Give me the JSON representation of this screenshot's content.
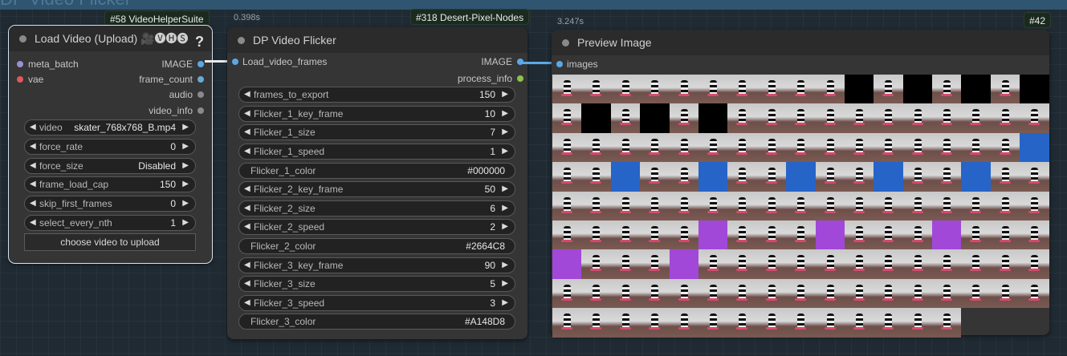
{
  "group": {
    "title": "DP Video Flicker"
  },
  "load_node": {
    "badge": "#58 VideoHelperSuite",
    "title": "Load Video (Upload) 🎥🅥🅗🅢",
    "help": "?",
    "inputs": [
      "meta_batch",
      "vae"
    ],
    "outputs": [
      "IMAGE",
      "frame_count",
      "audio",
      "video_info"
    ],
    "widgets": [
      {
        "label": "video",
        "value": "skater_768x768_B.mp4"
      },
      {
        "label": "force_rate",
        "value": "0"
      },
      {
        "label": "force_size",
        "value": "Disabled"
      },
      {
        "label": "frame_load_cap",
        "value": "150"
      },
      {
        "label": "skip_first_frames",
        "value": "0"
      },
      {
        "label": "select_every_nth",
        "value": "1"
      }
    ],
    "upload_label": "choose video to upload"
  },
  "flicker_node": {
    "time": "0.398s",
    "badge": "#318 Desert-Pixel-Nodes",
    "title": "DP Video Flicker",
    "input": "Load_video_frames",
    "outputs": [
      "IMAGE",
      "process_info"
    ],
    "widgets": [
      {
        "label": "frames_to_export",
        "value": "150",
        "type": "number"
      },
      {
        "label": "Flicker_1_key_frame",
        "value": "10",
        "type": "number"
      },
      {
        "label": "Flicker_1_size",
        "value": "7",
        "type": "number"
      },
      {
        "label": "Flicker_1_speed",
        "value": "1",
        "type": "number"
      },
      {
        "label": "Flicker_1_color",
        "value": "#000000",
        "type": "text"
      },
      {
        "label": "Flicker_2_key_frame",
        "value": "50",
        "type": "number"
      },
      {
        "label": "Flicker_2_size",
        "value": "6",
        "type": "number"
      },
      {
        "label": "Flicker_2_speed",
        "value": "2",
        "type": "number"
      },
      {
        "label": "Flicker_2_color",
        "value": "#2664C8",
        "type": "text"
      },
      {
        "label": "Flicker_3_key_frame",
        "value": "90",
        "type": "number"
      },
      {
        "label": "Flicker_3_size",
        "value": "5",
        "type": "number"
      },
      {
        "label": "Flicker_3_speed",
        "value": "3",
        "type": "number"
      },
      {
        "label": "Flicker_3_color",
        "value": "#A148D8",
        "type": "text"
      }
    ]
  },
  "preview_node": {
    "time": "3.247s",
    "badge": "#42",
    "title": "Preview Image",
    "input": "images",
    "frames": [
      "f",
      "f",
      "f",
      "f",
      "f",
      "f",
      "f",
      "f",
      "f",
      "f",
      "k",
      "f",
      "k",
      "f",
      "k",
      "f",
      "k",
      "f",
      "k",
      "f",
      "k",
      "f",
      "k",
      "f",
      "f",
      "f",
      "f",
      "f",
      "f",
      "f",
      "f",
      "f",
      "f",
      "f",
      "f",
      "f",
      "f",
      "f",
      "f",
      "f",
      "f",
      "f",
      "f",
      "f",
      "f",
      "f",
      "f",
      "f",
      "f",
      "f",
      "b",
      "f",
      "f",
      "b",
      "f",
      "f",
      "b",
      "f",
      "f",
      "b",
      "f",
      "f",
      "b",
      "f",
      "f",
      "b",
      "f",
      "f",
      "f",
      "f",
      "f",
      "f",
      "f",
      "f",
      "f",
      "f",
      "f",
      "f",
      "f",
      "f",
      "f",
      "f",
      "f",
      "f",
      "f",
      "f",
      "f",
      "f",
      "f",
      "f",
      "p",
      "f",
      "f",
      "f",
      "p",
      "f",
      "f",
      "f",
      "p",
      "f",
      "f",
      "f",
      "p",
      "f",
      "f",
      "f",
      "p",
      "f",
      "f",
      "f",
      "f",
      "f",
      "f",
      "f",
      "f",
      "f",
      "f",
      "f",
      "f",
      "f",
      "f",
      "f",
      "f",
      "f",
      "f",
      "f",
      "f",
      "f",
      "f",
      "f",
      "f",
      "f",
      "f",
      "f",
      "f",
      "f",
      "f",
      "f",
      "f",
      "f",
      "f",
      "f",
      "f",
      "f",
      "f",
      "f",
      "f",
      "f",
      "f",
      "f"
    ]
  },
  "colors": {
    "black": "#000000",
    "blue": "#2664C8",
    "purple": "#A148D8",
    "image_port": "#5aa9e6"
  }
}
